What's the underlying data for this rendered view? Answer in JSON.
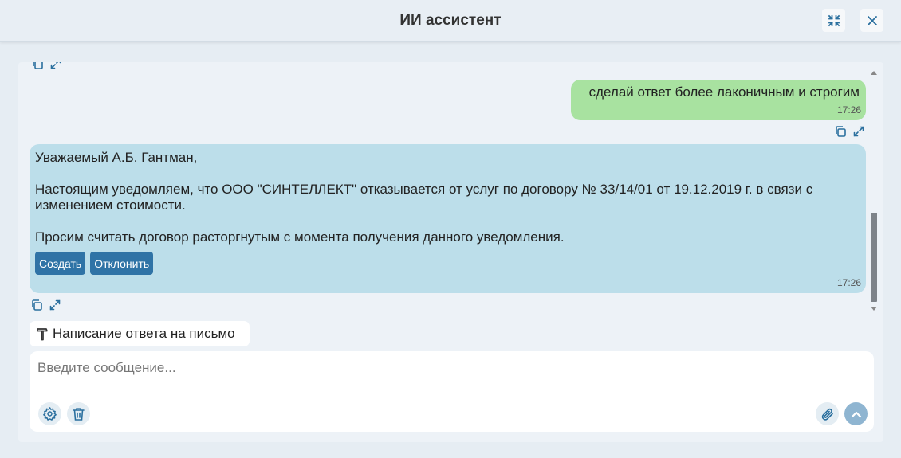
{
  "header": {
    "title": "ИИ ассистент",
    "minimize_icon": "collapse-icon",
    "close_icon": "close-icon"
  },
  "messages": {
    "user_message": {
      "text": "сделай ответ более лаконичным и строгим",
      "time": "17:26"
    },
    "bot_message": {
      "paragraphs": [
        "Уважаемый А.Б. Гантман,",
        "Настоящим уведомляем, что ООО \"СИНТЕЛЛЕКТ\" отказывается от услуг по договору № 33/14/01 от 19.12.2019 г. в связи с изменением стоимости.",
        "Просим считать договор расторгнутым с момента получения данного уведомления."
      ],
      "create_label": "Создать",
      "reject_label": "Отклонить",
      "time": "17:26"
    }
  },
  "skill_chip": {
    "icon": "hammer-icon",
    "label": "Написание ответа на письмо"
  },
  "composer": {
    "placeholder": "Введите сообщение...",
    "value": ""
  },
  "colors": {
    "user_bubble": "#a8e2a0",
    "bot_bubble": "#bcdeea",
    "accent": "#2f73a6",
    "panel": "#edf2f7"
  }
}
